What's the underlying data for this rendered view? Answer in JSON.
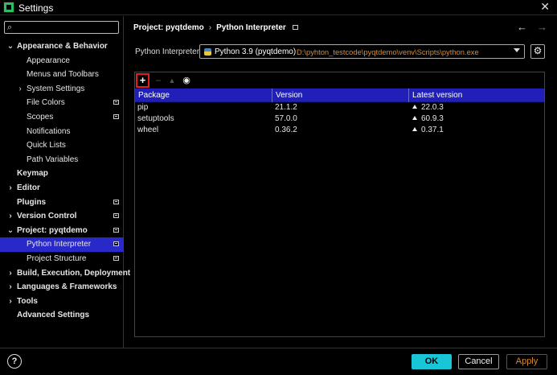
{
  "window": {
    "title": "Settings",
    "close_glyph": "✕"
  },
  "search": {
    "placeholder": "",
    "icon": "search-icon"
  },
  "sidebar": {
    "items": [
      {
        "label": "Appearance & Behavior",
        "bold": true,
        "arrow": "⌄",
        "badge": false,
        "indent": 0
      },
      {
        "label": "Appearance",
        "bold": false,
        "arrow": "",
        "badge": false,
        "indent": 1
      },
      {
        "label": "Menus and Toolbars",
        "bold": false,
        "arrow": "",
        "badge": false,
        "indent": 1
      },
      {
        "label": "System Settings",
        "bold": false,
        "arrow": "›",
        "badge": false,
        "indent": 1
      },
      {
        "label": "File Colors",
        "bold": false,
        "arrow": "",
        "badge": true,
        "indent": 1
      },
      {
        "label": "Scopes",
        "bold": false,
        "arrow": "",
        "badge": true,
        "indent": 1
      },
      {
        "label": "Notifications",
        "bold": false,
        "arrow": "",
        "badge": false,
        "indent": 1
      },
      {
        "label": "Quick Lists",
        "bold": false,
        "arrow": "",
        "badge": false,
        "indent": 1
      },
      {
        "label": "Path Variables",
        "bold": false,
        "arrow": "",
        "badge": false,
        "indent": 1
      },
      {
        "label": "Keymap",
        "bold": true,
        "arrow": "",
        "badge": false,
        "indent": 0
      },
      {
        "label": "Editor",
        "bold": true,
        "arrow": "›",
        "badge": false,
        "indent": 0
      },
      {
        "label": "Plugins",
        "bold": true,
        "arrow": "",
        "badge": true,
        "indent": 0
      },
      {
        "label": "Version Control",
        "bold": true,
        "arrow": "›",
        "badge": true,
        "indent": 0
      },
      {
        "label": "Project: pyqtdemo",
        "bold": true,
        "arrow": "⌄",
        "badge": true,
        "indent": 0
      },
      {
        "label": "Python Interpreter",
        "bold": false,
        "arrow": "",
        "badge": true,
        "indent": 1,
        "selected": true
      },
      {
        "label": "Project Structure",
        "bold": false,
        "arrow": "",
        "badge": true,
        "indent": 1
      },
      {
        "label": "Build, Execution, Deployment",
        "bold": true,
        "arrow": "›",
        "badge": false,
        "indent": 0
      },
      {
        "label": "Languages & Frameworks",
        "bold": true,
        "arrow": "›",
        "badge": false,
        "indent": 0
      },
      {
        "label": "Tools",
        "bold": true,
        "arrow": "›",
        "badge": false,
        "indent": 0
      },
      {
        "label": "Advanced Settings",
        "bold": true,
        "arrow": "",
        "badge": false,
        "indent": 0
      }
    ]
  },
  "breadcrumb": {
    "project": "Project: pyqtdemo",
    "separator": "›",
    "page": "Python Interpreter"
  },
  "nav": {
    "back": "←",
    "forward": "→"
  },
  "interpreter": {
    "label": "Python Interpreter:",
    "name": "Python 3.9 (pyqtdemo)",
    "path": "D:\\pyhton_testcode\\pyqtdemo\\venv\\Scripts\\python.exe",
    "settings_glyph": "⚙"
  },
  "toolbar": {
    "add": "+",
    "remove": "−",
    "upgrade": "▲",
    "show": "👁"
  },
  "packages": {
    "headers": [
      "Package",
      "Version",
      "Latest version"
    ],
    "rows": [
      {
        "name": "pip",
        "version": "21.1.2",
        "latest": "22.0.3"
      },
      {
        "name": "setuptools",
        "version": "57.0.0",
        "latest": "60.9.3"
      },
      {
        "name": "wheel",
        "version": "0.36.2",
        "latest": "0.37.1"
      }
    ]
  },
  "footer": {
    "help": "?",
    "ok": "OK",
    "cancel": "Cancel",
    "apply": "Apply"
  },
  "colors": {
    "accent": "#2929c9",
    "ok_button": "#19c6d8",
    "path_text": "#d98b2c",
    "highlight_box": "#e21d1d"
  }
}
